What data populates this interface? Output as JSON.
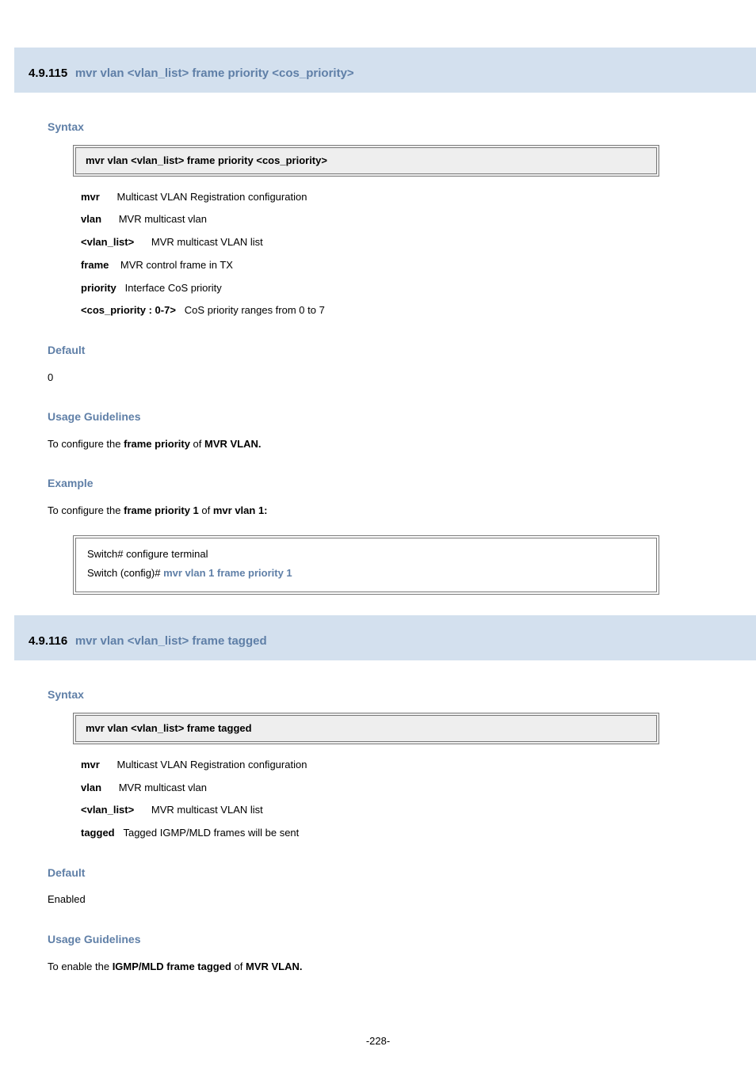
{
  "section1": {
    "num": "4.9.115",
    "title": "mvr vlan <vlan_list> frame priority <cos_priority>",
    "syntax_head": "Syntax",
    "syntax_cmd_prefix": "mvr vlan",
    "syntax_cmd_mid": "<vlan_list> frame priority",
    "syntax_cmd_tail": "<cos_priority>",
    "p_mvr": "mvr",
    "p_mvr_desc": "Multicast VLAN Registration configuration",
    "p_vlan": "vlan",
    "p_vlan_desc": "MVR multicast vlan",
    "p_vlanlist": "<vlan_list>",
    "p_vlanlist_desc": "MVR multicast VLAN list",
    "p_frame": "frame",
    "p_frame_desc": "MVR control frame in TX",
    "p_priority": "priority",
    "p_priority_desc": "Interface CoS priority",
    "p_cos": "<cos_priority : 0-7>",
    "p_cos_desc": "CoS priority ranges from 0 to 7",
    "default_head": "Default",
    "default_val": "0",
    "usage_head": "Usage Guidelines",
    "usage_l1a": "To configure the ",
    "usage_l1b": "frame priority",
    "usage_l1c": " of ",
    "usage_l1d": "MVR VLAN.",
    "example_head": "Example",
    "ex_l1a": "To configure the ",
    "ex_l1b": "frame priority 1",
    "ex_l1c": " of ",
    "ex_l1d": "mvr vlan 1:",
    "ex_box_l1": "Switch# configure terminal",
    "ex_box_l2a": "Switch (config)# ",
    "ex_box_l2b": "mvr vlan 1 frame priority 1"
  },
  "section2": {
    "num": "4.9.116",
    "title": "mvr vlan <vlan_list> frame tagged",
    "syntax_head": "Syntax",
    "syntax_cmd_prefix": "mvr vlan",
    "syntax_cmd_mid": "<vlan_list> frame tagged",
    "p_mvr": "mvr",
    "p_mvr_desc": "Multicast VLAN Registration configuration",
    "p_vlan": "vlan",
    "p_vlan_desc": "MVR multicast vlan",
    "p_vlanlist": "<vlan_list>",
    "p_vlanlist_desc": "MVR multicast VLAN list",
    "p_tagged": "tagged",
    "p_tagged_desc": "Tagged IGMP/MLD frames will be sent",
    "default_head": "Default",
    "default_val": "Enabled",
    "usage_head": "Usage Guidelines",
    "usage_l1a": "To enable the ",
    "usage_l1b": "IGMP/MLD frame tagged",
    "usage_l1c": " of ",
    "usage_l1d": "MVR VLAN."
  },
  "footer": "-228-"
}
